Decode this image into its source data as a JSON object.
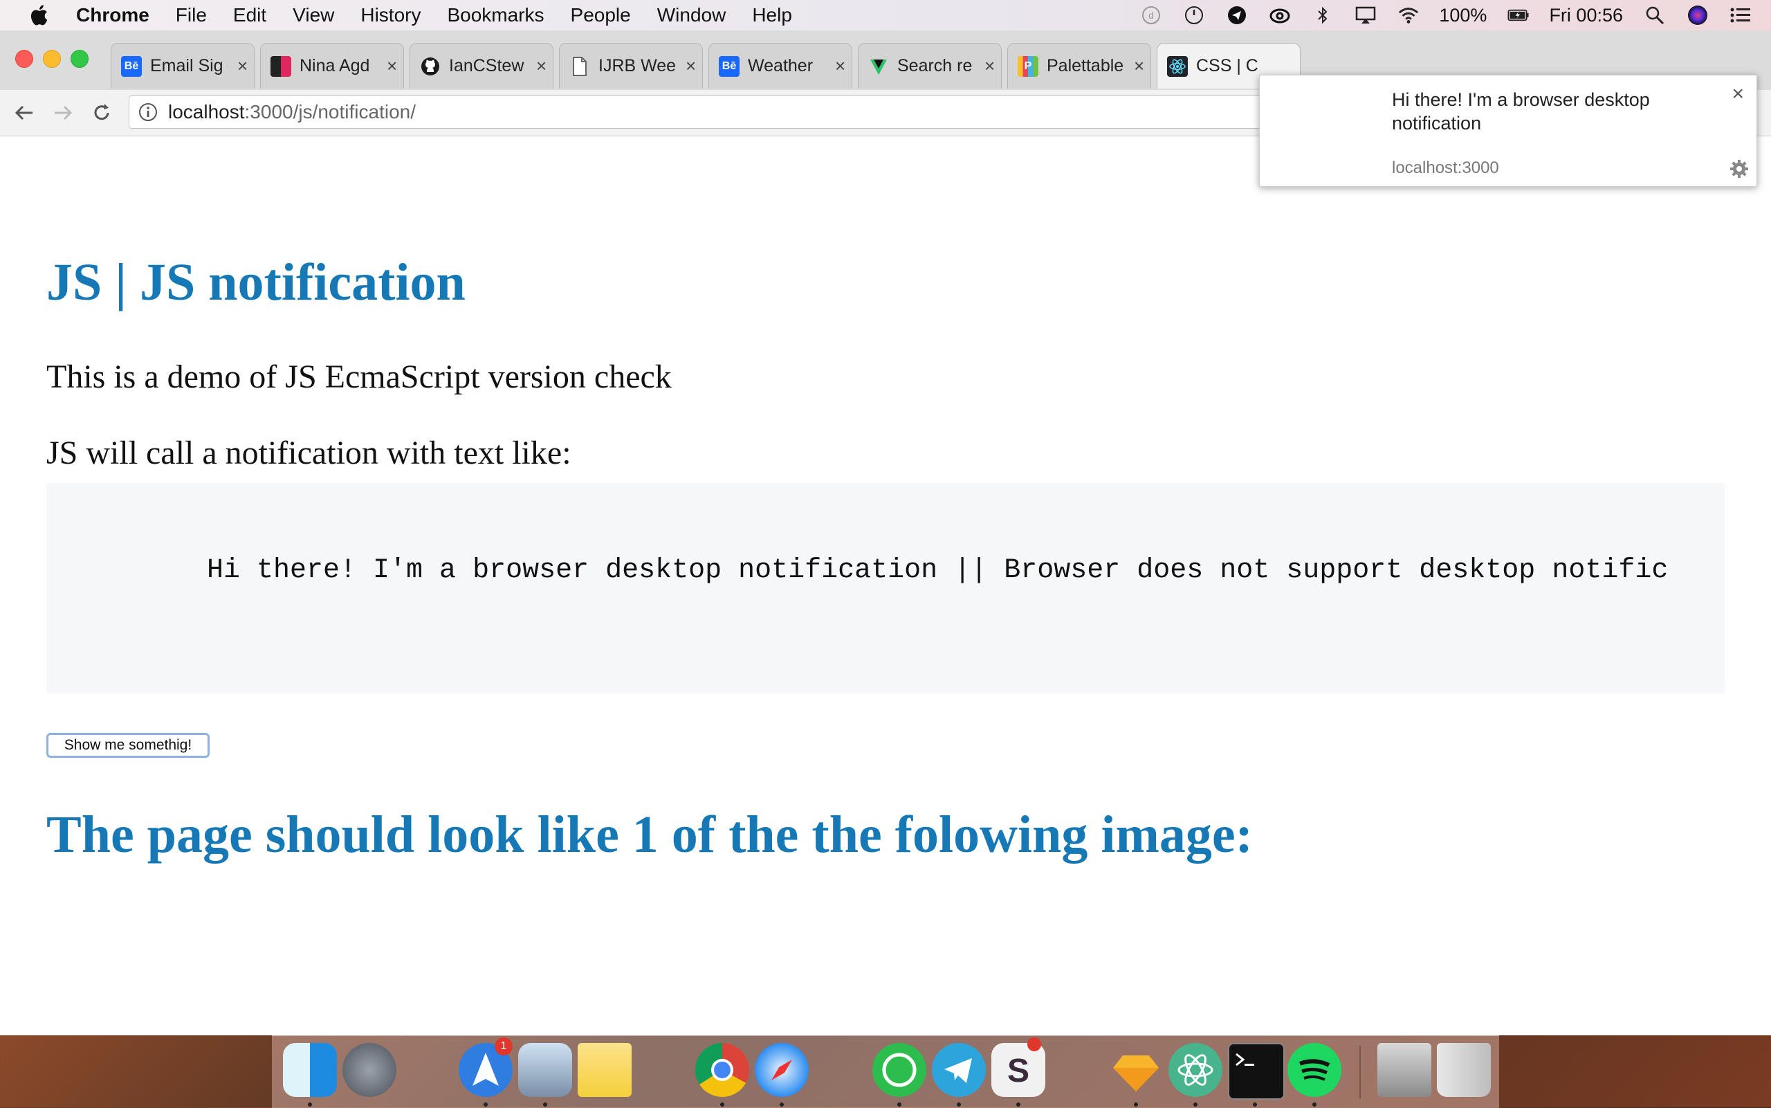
{
  "menubar": {
    "items": [
      "Chrome",
      "File",
      "Edit",
      "View",
      "History",
      "Bookmarks",
      "People",
      "Window",
      "Help"
    ],
    "battery": "100%",
    "clock": "Fri 00:56"
  },
  "browser": {
    "tabs": [
      {
        "label": "Email Sig",
        "icon": "behance-icon"
      },
      {
        "label": "Nina Agd",
        "icon": "page-icon"
      },
      {
        "label": "IanCStew",
        "icon": "github-icon"
      },
      {
        "label": "IJRB Wee",
        "icon": "document-icon"
      },
      {
        "label": "Weather",
        "icon": "behance-icon"
      },
      {
        "label": "Search re",
        "icon": "search-favicon-icon"
      },
      {
        "label": "Palettable",
        "icon": "palettable-icon"
      },
      {
        "label": "CSS | C",
        "icon": "react-icon"
      }
    ],
    "url_host": "localhost",
    "url_path": ":3000/js/notification/"
  },
  "page": {
    "title": "JS | JS notification",
    "intro": "This is a demo of JS EcmaScript version check",
    "lead": "JS will call a notification with text like:",
    "code": "Hi there! I'm a browser desktop notification || Browser does not support desktop notific",
    "button_label": "Show me somethig!",
    "subtitle": "The page should look like 1 of the the folowing image:"
  },
  "notification": {
    "title": "Hi there! I'm a browser desktop notification",
    "source": "localhost:3000",
    "close": "×"
  },
  "dock": {
    "badges": {
      "mail": "1"
    }
  },
  "colors": {
    "heading": "#1679b6",
    "code_bg": "#f6f7f9",
    "button_border": "#8fb3e0"
  }
}
